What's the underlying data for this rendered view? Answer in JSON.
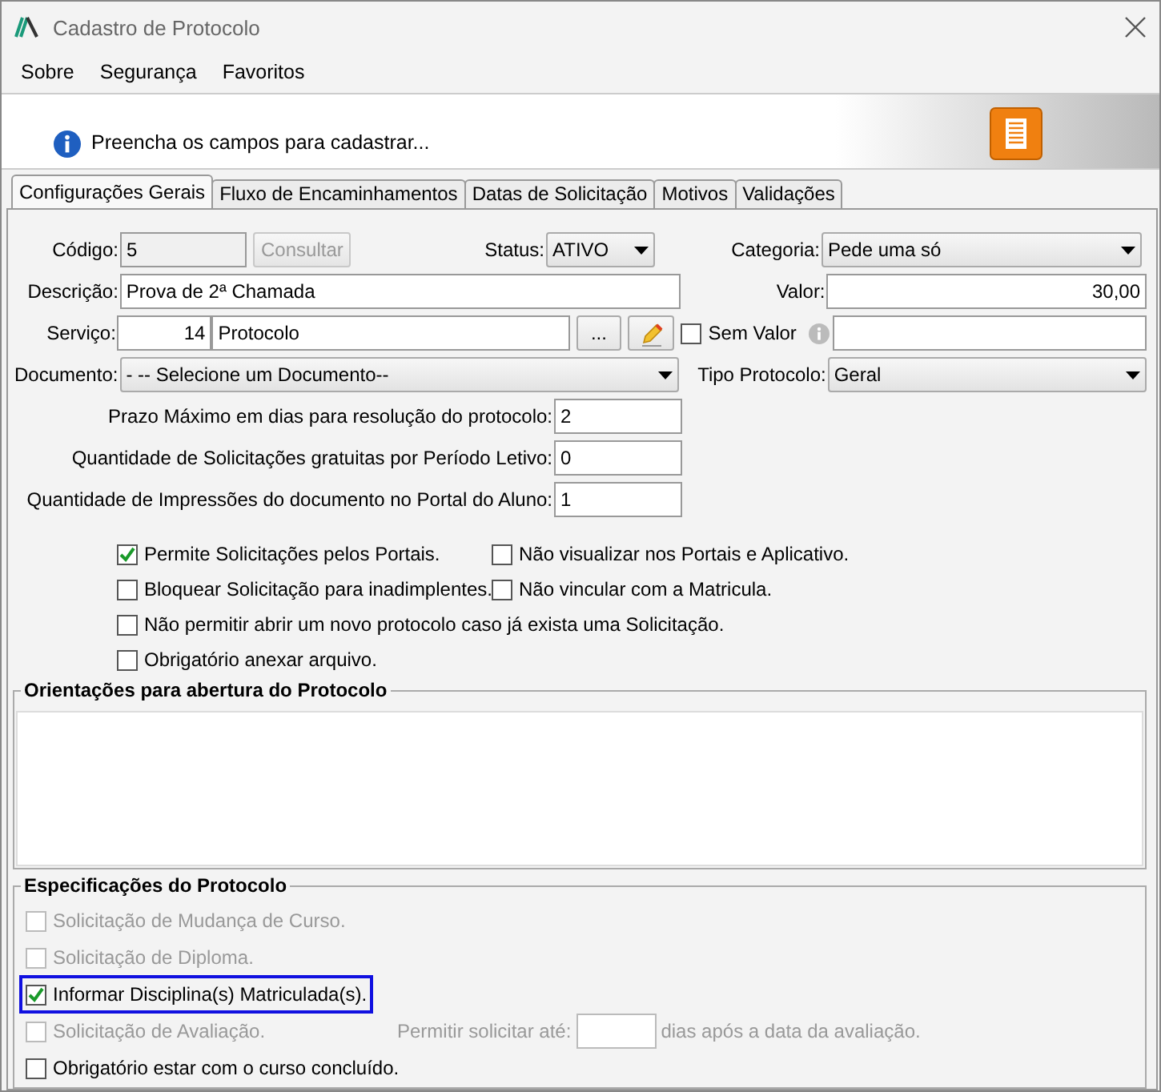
{
  "window": {
    "title": "Cadastro de Protocolo"
  },
  "menu": [
    {
      "label": "Sobre"
    },
    {
      "label": "Segurança"
    },
    {
      "label": "Favoritos"
    }
  ],
  "banner": {
    "message": "Preencha os campos para cadastrar..."
  },
  "tabs": [
    {
      "label": "Configurações Gerais",
      "selected": true
    },
    {
      "label": "Fluxo de Encaminhamentos",
      "selected": false
    },
    {
      "label": "Datas de Solicitação",
      "selected": false
    },
    {
      "label": "Motivos",
      "selected": false
    },
    {
      "label": "Validações",
      "selected": false
    }
  ],
  "form": {
    "codigo": {
      "label": "Código:",
      "value": "5"
    },
    "consultar_button": {
      "label": "Consultar",
      "disabled": true
    },
    "status": {
      "label": "Status:",
      "value": "ATIVO"
    },
    "categoria": {
      "label": "Categoria:",
      "value": "Pede uma só"
    },
    "descricao": {
      "label": "Descrição:",
      "value": "Prova de 2ª Chamada"
    },
    "valor": {
      "label": "Valor:",
      "value": "30,00"
    },
    "servico": {
      "label": "Serviço:",
      "code": "14",
      "name": "Protocolo",
      "browse_button": "..."
    },
    "sem_valor": {
      "label": "Sem Valor",
      "checked": false
    },
    "documento": {
      "label": "Documento:",
      "value": "- -- Selecione um Documento--"
    },
    "tipo_protocolo": {
      "label": "Tipo Protocolo:",
      "value": "Geral"
    },
    "numeric_fields": [
      {
        "label": "Prazo Máximo em dias para resolução do protocolo:",
        "value": "2"
      },
      {
        "label": "Quantidade de Solicitações gratuitas por Período Letivo:",
        "value": "0"
      },
      {
        "label": "Quantidade de Impressões do documento no Portal do Aluno:",
        "value": "1"
      }
    ]
  },
  "options": [
    [
      {
        "label": "Permite Solicitações pelos Portais.",
        "checked": true
      },
      {
        "label": "Não visualizar nos Portais e Aplicativo.",
        "checked": false
      }
    ],
    [
      {
        "label": "Bloquear Solicitação para inadimplentes.",
        "checked": false
      },
      {
        "label": "Não vincular com a Matricula.",
        "checked": false
      }
    ],
    [
      {
        "label": "Não permitir abrir um novo protocolo caso já exista uma Solicitação.",
        "checked": false
      }
    ],
    [
      {
        "label": "Obrigatório anexar arquivo.",
        "checked": false
      }
    ]
  ],
  "orientacoes": {
    "title": "Orientações para abertura do Protocolo"
  },
  "especificacoes": {
    "title": "Especificações do Protocolo",
    "items": [
      {
        "kind": "plain",
        "label": "Solicitação de Mudança de Curso.",
        "checked": false,
        "disabled": true,
        "highlighted": false
      },
      {
        "kind": "plain",
        "label": "Solicitação de Diploma.",
        "checked": false,
        "disabled": true,
        "highlighted": false
      },
      {
        "kind": "plain",
        "label": "Informar Disciplina(s) Matriculada(s).",
        "checked": true,
        "disabled": false,
        "highlighted": true
      },
      {
        "kind": "days",
        "label": "Solicitação de Avaliação.",
        "checked": false,
        "disabled": true,
        "highlighted": false,
        "days_label": "Permitir solicitar até:",
        "days_suffix": "dias após a data da avaliação."
      },
      {
        "kind": "plain",
        "label": "Obrigatório estar com o curso concluído.",
        "checked": false,
        "disabled": false,
        "highlighted": false
      }
    ]
  }
}
